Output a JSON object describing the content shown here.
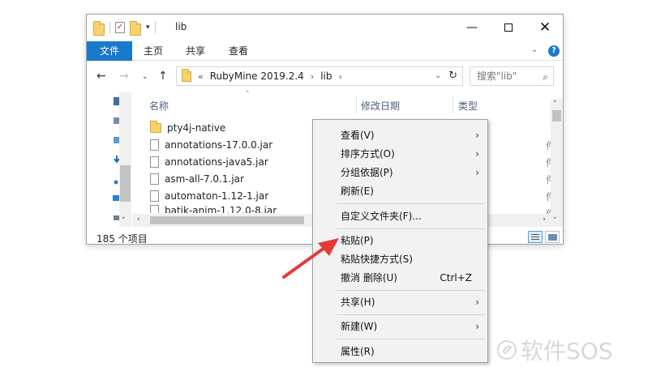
{
  "window": {
    "title": "lib",
    "controls": {
      "minimize": "—",
      "maximize": "",
      "close": "✕"
    }
  },
  "ribbon": {
    "tabs": {
      "file": "文件",
      "home": "主页",
      "share": "共享",
      "view": "查看"
    },
    "collapse_glyph": "⌄",
    "help_glyph": "?"
  },
  "nav": {
    "back": "←",
    "forward": "→",
    "recent": "⌄",
    "up": "↑",
    "address": {
      "overflow": "«",
      "segments": [
        "RubyMine 2019.2.4",
        "lib"
      ],
      "separator": "›"
    },
    "refresh": "↻",
    "search_placeholder": "搜索\"lib\"",
    "search_icon": "⌕"
  },
  "columns": {
    "name": "名称",
    "date_modified": "修改日期",
    "type": "类型",
    "sort_glyph": "˄"
  },
  "files": [
    {
      "name": "pty4j-native",
      "kind": "folder"
    },
    {
      "name": "annotations-17.0.0.jar",
      "kind": "file"
    },
    {
      "name": "annotations-java5.jar",
      "kind": "file"
    },
    {
      "name": "asm-all-7.0.1.jar",
      "kind": "file"
    },
    {
      "name": "automaton-1.12-1.jar",
      "kind": "file"
    },
    {
      "name": "batik-anim-1.12.0-8.jar",
      "kind": "file"
    }
  ],
  "type_fragments": [
    "件",
    "件",
    "件",
    "件",
    "件"
  ],
  "status": {
    "item_count": "185 个项目"
  },
  "scroll_glyphs": {
    "up": "˄",
    "down": "˅",
    "left": "‹",
    "right": "›"
  },
  "context_menu": {
    "items": [
      {
        "label": "查看(V)",
        "submenu": true
      },
      {
        "label": "排序方式(O)",
        "submenu": true
      },
      {
        "label": "分组依据(P)",
        "submenu": true
      },
      {
        "label": "刷新(E)",
        "submenu": false
      },
      {
        "label": "自定义文件夹(F)...",
        "submenu": false
      },
      {
        "label": "粘贴(P)",
        "submenu": false
      },
      {
        "label": "粘贴快捷方式(S)",
        "submenu": false
      },
      {
        "label": "撤消 删除(U)",
        "submenu": false,
        "shortcut": "Ctrl+Z"
      },
      {
        "label": "共享(H)",
        "submenu": true
      },
      {
        "label": "新建(W)",
        "submenu": true
      },
      {
        "label": "属性(R)",
        "submenu": false
      }
    ],
    "submenu_glyph": "›"
  },
  "annotation": {
    "arrow_color": "#e53935"
  },
  "watermark": {
    "text": "软件SOS"
  },
  "colors": {
    "accent": "#1979ca",
    "folder": "#f6d36b"
  }
}
